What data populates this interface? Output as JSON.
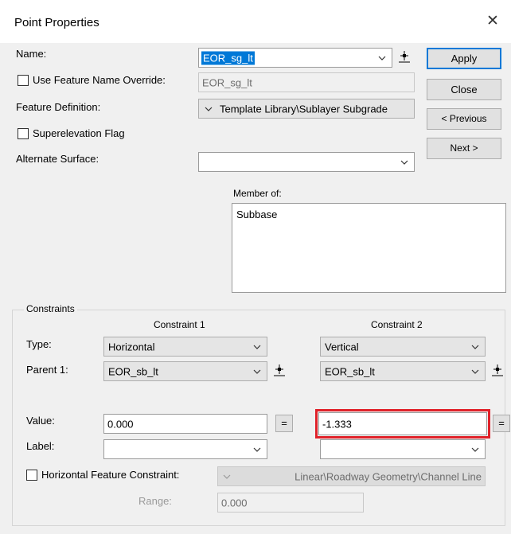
{
  "window": {
    "title": "Point Properties"
  },
  "labels": {
    "name": "Name:",
    "feature_override": "Use Feature Name Override:",
    "feature_definition": "Feature Definition:",
    "superelevation": "Superelevation Flag",
    "alternate_surface": "Alternate Surface:",
    "member_of": "Member of:",
    "constraints": "Constraints",
    "constraint1": "Constraint 1",
    "constraint2": "Constraint 2",
    "type": "Type:",
    "parent1": "Parent 1:",
    "value": "Value:",
    "label": "Label:",
    "horizontal_feature": "Horizontal Feature Constraint:",
    "range": "Range:"
  },
  "fields": {
    "name_value": "EOR_sg_lt",
    "override_value": "EOR_sg_lt",
    "feature_definition_value": "Template Library\\Sublayer Subgrade",
    "alternate_surface_value": "",
    "member_of_items": [
      "Subbase"
    ],
    "c1_type": "Horizontal",
    "c2_type": "Vertical",
    "c1_parent": "EOR_sb_lt",
    "c2_parent": "EOR_sb_lt",
    "c1_value": "0.000",
    "c2_value": "-1.333",
    "c1_label": "",
    "c2_label": "",
    "horizontal_feature_value": "Linear\\Roadway Geometry\\Channel Line",
    "range_value": "0.000"
  },
  "buttons": {
    "apply": "Apply",
    "close": "Close",
    "previous": "< Previous",
    "next": "Next >",
    "equals": "="
  },
  "checkboxes": {
    "use_feature_name_override": false,
    "superelevation_flag": false,
    "horizontal_feature_constraint": false
  },
  "colors": {
    "selection": "#0078d7",
    "highlight_box": "#e0222a",
    "dialog_bg": "#f0f0f0"
  }
}
